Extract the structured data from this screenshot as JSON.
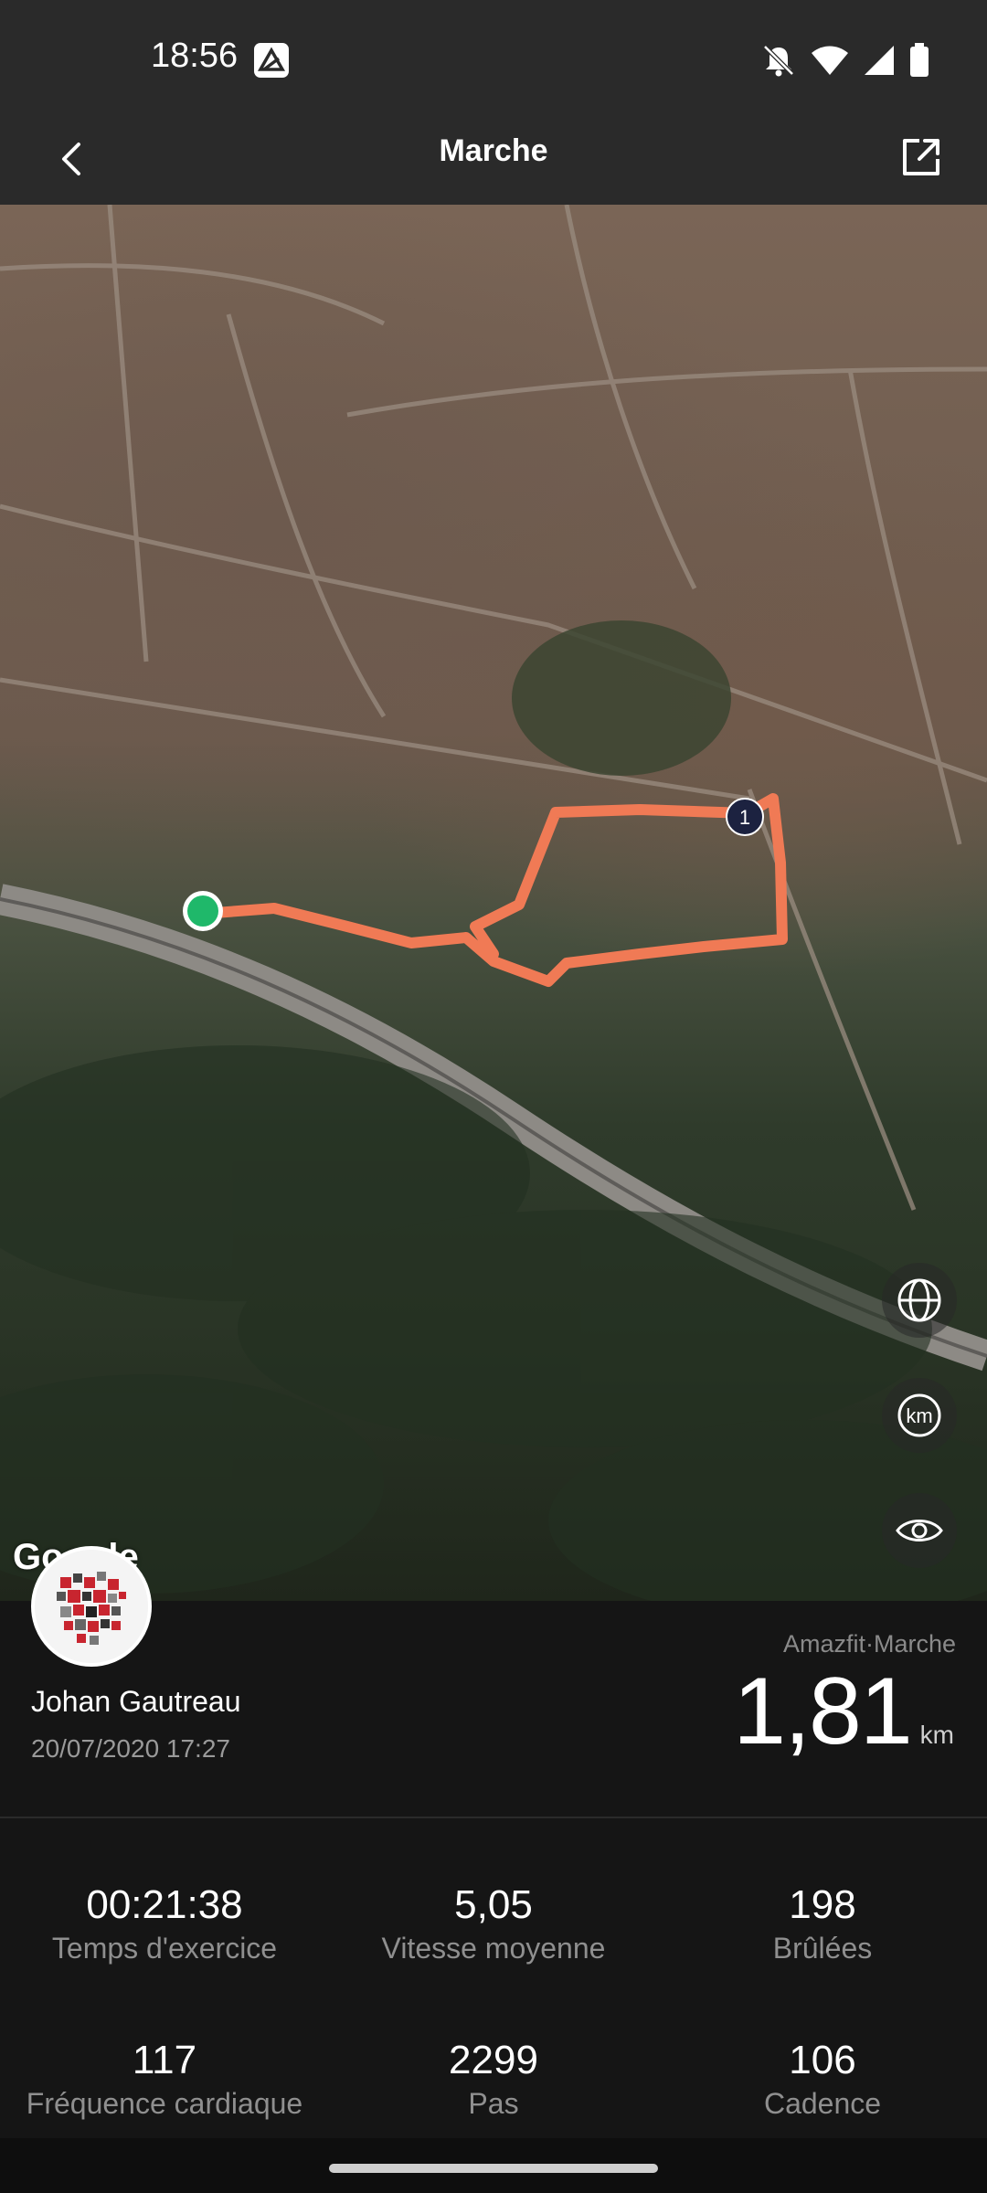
{
  "status_bar": {
    "time": "18:56",
    "icons": [
      "app-notification-icon",
      "mute-icon",
      "wifi-icon",
      "signal-icon",
      "battery-icon"
    ]
  },
  "header": {
    "title": "Marche",
    "back_icon": "chevron-left-icon",
    "share_icon": "share-icon"
  },
  "map": {
    "attribution": "Google",
    "lap_marker": "1",
    "controls": [
      "globe-icon",
      "km-icon",
      "eye-icon"
    ],
    "km_label": "km",
    "route_color": "#f07a55",
    "start_color": "#1fb86a"
  },
  "activity": {
    "source": "Amazfit·Marche",
    "user_name": "Johan Gautreau",
    "date_time": "20/07/2020 17:27",
    "distance": "1,81",
    "distance_unit": "km"
  },
  "stats": [
    {
      "value": "00:21:38",
      "label": "Temps d'exercice"
    },
    {
      "value": "5,05",
      "label": "Vitesse moyenne"
    },
    {
      "value": "198",
      "label": "Brûlées"
    },
    {
      "value": "117",
      "label": "Fréquence cardiaque"
    },
    {
      "value": "2299",
      "label": "Pas"
    },
    {
      "value": "106",
      "label": "Cadence"
    }
  ]
}
